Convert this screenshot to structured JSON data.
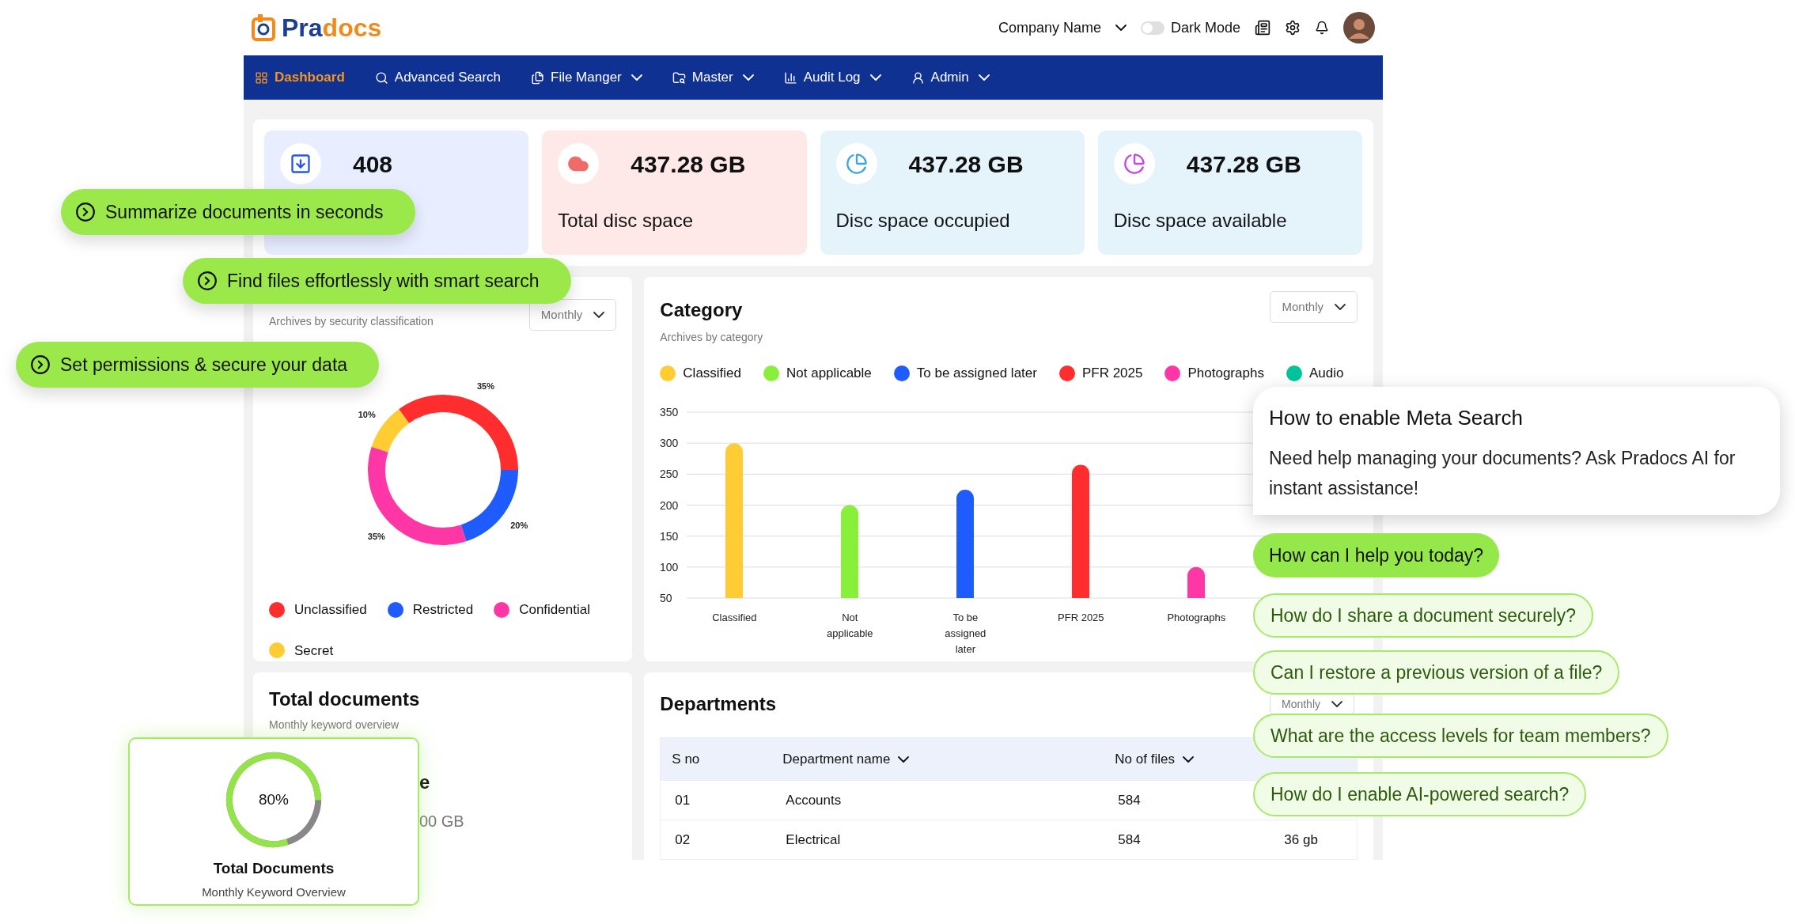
{
  "header": {
    "logo": {
      "text_parts": [
        {
          "text": "Pra",
          "color": "#1c3f8f"
        },
        {
          "text": "docs",
          "color": "#f08a1c"
        }
      ]
    },
    "company": "Company Name",
    "dark_mode": {
      "label": "Dark Mode",
      "on": false
    }
  },
  "nav": [
    {
      "label": "Dashboard",
      "selected": true,
      "has_menu": false
    },
    {
      "label": "Advanced Search",
      "selected": false,
      "has_menu": false
    },
    {
      "label": "File Manger",
      "selected": false,
      "has_menu": true
    },
    {
      "label": "Master",
      "selected": false,
      "has_menu": true
    },
    {
      "label": "Audit Log",
      "selected": false,
      "has_menu": true
    },
    {
      "label": "Admin",
      "selected": false,
      "has_menu": true
    }
  ],
  "stats": [
    {
      "value": "408",
      "color": "#e8edff"
    },
    {
      "value": "437.28 GB",
      "label": "Total disc space",
      "color": "#ffe8e8"
    },
    {
      "value": "437.28 GB",
      "label": "Disc space occupied",
      "color": "#e5f3fb"
    },
    {
      "value": "437.28 GB",
      "label": "Disc space available",
      "color": "#e5f3fb"
    }
  ],
  "security": {
    "subtitle": "Archives by security classification",
    "period": "Monthly",
    "legend": [
      {
        "color": "#ff2d2d"
      },
      {
        "color": "#1f5cff"
      },
      {
        "color": "#ff37a6"
      },
      {
        "color": "#ffcc33"
      }
    ],
    "chart_data": {
      "type": "donut",
      "categories": [
        "Unclassified",
        "Restricted",
        "Confidential",
        "Secret"
      ],
      "values": [
        35,
        20,
        35,
        10
      ],
      "value_labels": [
        "35%",
        "20%",
        "35%",
        "10%"
      ]
    }
  },
  "category": {
    "title": "Category",
    "subtitle": "Archives by category",
    "period": "Monthly",
    "legend": [
      {
        "label": "Classified",
        "color": "#ffcc33"
      },
      {
        "label": "Not applicable",
        "color": "#88f03a"
      },
      {
        "label": "To be assigned later",
        "color": "#1f5cff"
      },
      {
        "label": "PFR 2025",
        "color": "#ff2d2d"
      },
      {
        "label": "Photographs",
        "color": "#ff37a6"
      },
      {
        "label": "Audio",
        "color": "#00c49a"
      }
    ],
    "chart_data": {
      "type": "bar",
      "categories": [
        "Classified",
        "Not applicable",
        "To be assigned later",
        "PFR 2025",
        "Photographs"
      ],
      "values": [
        300,
        200,
        225,
        265,
        100
      ],
      "ylim": [
        50,
        350
      ],
      "yticks": [
        50,
        100,
        150,
        200,
        250,
        300,
        350
      ],
      "grid": true
    }
  },
  "total_documents": {
    "title": "Total documents",
    "subtitle": "Monthly keyword overview",
    "column_1": "e",
    "column_2": "00 GB"
  },
  "departments": {
    "title": "Departments",
    "period": "Monthly",
    "columns": [
      {
        "label": "S no",
        "sortable": false
      },
      {
        "label": "Department name",
        "sortable": true
      },
      {
        "label": "No of files",
        "sortable": true
      }
    ],
    "rows": [
      {
        "cells": [
          "01",
          "Accounts",
          "584"
        ]
      },
      {
        "cells": [
          "02",
          "Electrical",
          "584",
          "36 gb"
        ]
      }
    ]
  },
  "feature_pills": [
    "Summarize documents in seconds",
    "Find files effortlessly with smart search",
    "Set permissions & secure your data"
  ],
  "progress_card": {
    "reading": "80%",
    "title": "Total Documents",
    "subtitle": "Monthly Keyword Overview"
  },
  "assistant": {
    "title": "How to enable Meta Search",
    "message": "Need help managing your documents? Ask Pradocs AI for instant assistance!",
    "bubbles": [
      {
        "kind": "greeting",
        "text": "How can I help you today?"
      },
      {
        "kind": "suggestion",
        "text": "How do I share a document securely?"
      },
      {
        "kind": "suggestion",
        "text": "Can I restore a previous version of a file?"
      },
      {
        "kind": "suggestion",
        "text": "What are the access levels for team members?"
      },
      {
        "kind": "suggestion",
        "text": "How do I enable AI-powered search?"
      }
    ]
  }
}
